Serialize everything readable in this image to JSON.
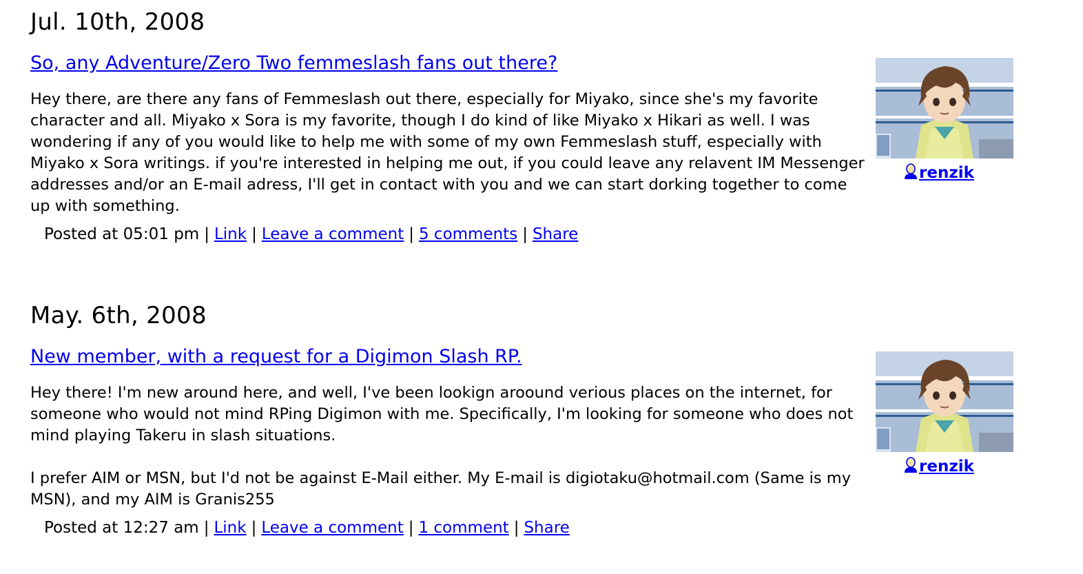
{
  "entries": [
    {
      "date": "Jul. 10th, 2008",
      "subject": "So, any Adventure/Zero Two femmeslash fans out there?",
      "paragraphs": [
        "Hey there, are there any fans of Femmeslash out there, especially for Miyako, since she's my favorite character and all. Miyako x Sora is my favorite, though I do kind of like Miyako x Hikari as well. I was wondering if any of you would like to help me with some of my own Femmeslash stuff, especially with Miyako x Sora writings. if you're interested in helping me out, if you could leave any relavent IM Messenger addresses and/or an E-mail adress, I'll get in contact with you and we can start dorking together to come up with something."
      ],
      "posted": "Posted at 05:01 pm",
      "link_label": "Link",
      "leave_comment_label": "Leave a comment",
      "comments_label": "5 comments",
      "share_label": "Share",
      "username": "renzik"
    },
    {
      "date": "May. 6th, 2008",
      "subject": "New member, with a request for a Digimon Slash RP.",
      "paragraphs": [
        "Hey there! I'm new around here, and well, I've been lookign aroound verious places on the internet, for someone who would not mind RPing Digimon with me. Specifically, I'm looking for someone who does not mind playing Takeru in slash situations.",
        "I prefer AIM or MSN, but I'd not be against E-Mail either. My E-mail is digiotaku@hotmail.com (Same is my MSN), and my AIM is Granis255"
      ],
      "posted": "Posted at 12:27 am",
      "link_label": "Link",
      "leave_comment_label": "Leave a comment",
      "comments_label": "1 comment",
      "share_label": "Share",
      "username": "renzik"
    }
  ],
  "separator": "|",
  "colors": {
    "link": "#0000ee",
    "text": "#000000",
    "background": "#ffffff"
  },
  "icons": {
    "user": "user-head-icon",
    "userpic": "userpic-avatar"
  }
}
